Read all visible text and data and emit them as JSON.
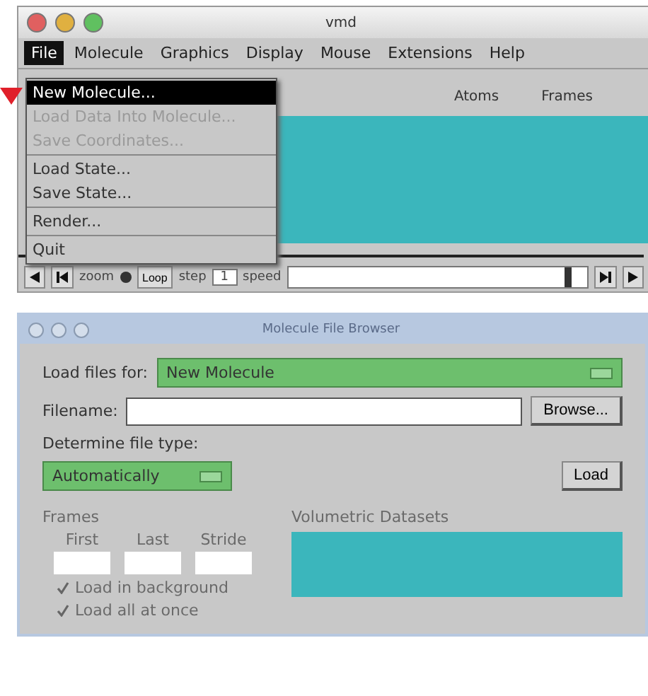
{
  "main_window": {
    "title": "vmd",
    "menubar": [
      {
        "label": "File",
        "selected": true
      },
      {
        "label": "Molecule",
        "selected": false
      },
      {
        "label": "Graphics",
        "selected": false
      },
      {
        "label": "Display",
        "selected": false
      },
      {
        "label": "Mouse",
        "selected": false
      },
      {
        "label": "Extensions",
        "selected": false
      },
      {
        "label": "Help",
        "selected": false
      }
    ],
    "columns": [
      "Atoms",
      "Frames"
    ],
    "playback": {
      "zoom_label": "zoom",
      "zoom_checked": true,
      "style": "Loop",
      "step_label": "step",
      "step": "1",
      "speed_label": "speed",
      "speed": {
        "level": 0.95
      }
    }
  },
  "file_menu": [
    {
      "kind": "item",
      "label": "New Molecule...",
      "selected": true,
      "disabled": false
    },
    {
      "kind": "item",
      "label": "Load Data Into Molecule...",
      "selected": false,
      "disabled": true
    },
    {
      "kind": "item",
      "label": "Save Coordinates...",
      "selected": false,
      "disabled": true
    },
    {
      "kind": "separator"
    },
    {
      "kind": "item",
      "label": "Load State...",
      "selected": false,
      "disabled": false
    },
    {
      "kind": "item",
      "label": "Save State...",
      "selected": false,
      "disabled": false
    },
    {
      "kind": "separator"
    },
    {
      "kind": "item",
      "label": "Render...",
      "selected": false,
      "disabled": false
    },
    {
      "kind": "separator"
    },
    {
      "kind": "item",
      "label": "Quit",
      "selected": false,
      "disabled": false
    }
  ],
  "browser_window": {
    "title": "Molecule File Browser",
    "load_for_label": "Load files for:",
    "load_for_value": "New Molecule",
    "filename_label": "Filename:",
    "browse_button": "Browse...",
    "filetype_label": "Determine file type:",
    "filetype_value": "Automatically",
    "load_button": "Load",
    "frames": {
      "title": "Frames",
      "disabled": true,
      "fields": [
        "First",
        "Last",
        "Stride"
      ],
      "options": [
        {
          "label": "Load in background",
          "checked": true
        },
        {
          "label": "Load all at once",
          "checked": true
        }
      ]
    },
    "volumetric_title": "Volumetric Datasets"
  }
}
